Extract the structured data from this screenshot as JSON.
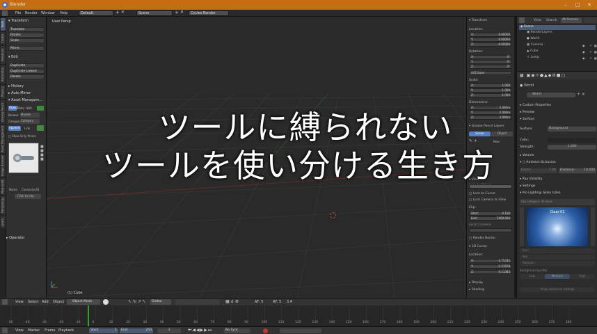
{
  "window": {
    "title": "Blender"
  },
  "menubar": {
    "items": [
      "File",
      "Render",
      "Window",
      "Help"
    ],
    "layout": "Default",
    "scene": "Scene",
    "engine": "Cycles Render"
  },
  "tabs": [
    "Tools",
    "Create",
    "Relations",
    "Animation",
    "Physics",
    "Grease Pencil",
    "Asset Management",
    "Image Browser",
    "MeasureIt",
    "Retopology",
    "Learn"
  ],
  "toolshelf": {
    "transform_header": "Transform",
    "transform_buttons": [
      "Translate",
      "Rotate",
      "Scale",
      "Mirror"
    ],
    "edit_header": "Edit",
    "edit_buttons": [
      "Duplicate",
      "Duplicate Linked",
      "Delete"
    ],
    "history_header": "History",
    "auto_mirror": "Auto Mirror",
    "asset_header": "Asset Managem...",
    "asset_row1": [
      "Object",
      "Mate",
      "HDR"
    ],
    "asset_browse": "Browse",
    "asset_models": "Models",
    "asset_category": "Category",
    "asset_replace": "Replace",
    "asset_append": "Append",
    "asset_link": "Link",
    "show_only_preview": "Show Only Previe",
    "name_label": "Name",
    "name_value": "Connector01",
    "click_to_import": "Click to imp",
    "operator_header": "Operator"
  },
  "viewport": {
    "label": "User Persp",
    "object_label": "(1) Cube"
  },
  "overlay": {
    "line1": "ツールに縛られない",
    "line2": "ツールを使い分ける生き方"
  },
  "npanel": {
    "transform_header": "Transform",
    "location_label": "Location:",
    "location": [
      "X:",
      "0.00000",
      "Y:",
      "0.00000",
      "Z:",
      "0.00000"
    ],
    "rotation_label": "Rotation:",
    "rotation": [
      "X:",
      "0°",
      "Y:",
      "0°",
      "Z:",
      "0°"
    ],
    "euler": "XYZ Euler",
    "scale_label": "Scale:",
    "scale": [
      "X:",
      "1.000",
      "Y:",
      "1.000",
      "Z:",
      "1.000"
    ],
    "dimensions_label": "Dimensions:",
    "dimensions": [
      "X:",
      "2.000m",
      "Y:",
      "2.000m",
      "Z:",
      "2.000m"
    ],
    "layers_header": "Grease Pencil Layers",
    "scene_btn": "Scene",
    "object_btn": "Object",
    "new_btn": "New",
    "view_header": "View",
    "lock_to_object": "Lock to Object:",
    "lock_to_cursor": "Lock to Cursor",
    "lock_camera": "Lock Camera to View",
    "clip_label": "Clip:",
    "clip_start_label": "Start:",
    "clip_start": "0.100",
    "clip_end_label": "End:",
    "clip_end": "1000.000",
    "local_camera": "Local Camera:",
    "render_border": "Render Border",
    "cursor_header": "3D Cursor",
    "cursor_location_label": "Location:",
    "cursor": [
      "X:",
      "-1.75335",
      "Y:",
      "-2.31528",
      "Z:",
      "0.11383"
    ],
    "display_header": "Display",
    "shading_header": "Shading"
  },
  "outliner": {
    "menu": [
      "View",
      "Search",
      "All Scenes"
    ],
    "items": [
      "Scene",
      "RenderLayers",
      "World",
      "Camera",
      "Cube",
      "Lamp"
    ]
  },
  "properties": {
    "world_label": "World",
    "world_field": "World",
    "panels": [
      "Custom Properties",
      "Preview",
      "Surface"
    ],
    "surface_label": "Surface:",
    "surface_value": "Background",
    "color_label": "Color:",
    "strength_label": "Strength:",
    "strength_value": "1.000",
    "volume": "Volume",
    "ao": "Ambient Occlusion",
    "factor_label": "Factor:",
    "factor_value": "1.00",
    "distance_label": "Distance:",
    "distance_value": "10.000",
    "ray_visibility": "Ray Visibility",
    "settings": "Settings",
    "pro_lighting": "Pro Lighting: Skies (Lite)",
    "sky_category_label": "Sky category:",
    "sky_category_value": "All Skies",
    "sky_name": "Clear 01",
    "sun_label": "Sun:",
    "sky_label": "Sky:",
    "rotation_label": "Rotation:",
    "bg_quality": "Background quality:",
    "quality_options": [
      "Low",
      "Medium",
      "High"
    ],
    "show_advanced": "Show advanced settings"
  },
  "header": {
    "items": [
      "View",
      "Select",
      "Add",
      "Object"
    ],
    "mode": "Object Mode",
    "pivot": "Global",
    "snap": "AF: 5",
    "snap2": "AF: 5",
    "extra": "3.4"
  },
  "timeline": {
    "ticks": [
      "-50",
      "-40",
      "-30",
      "-20",
      "-10",
      "0",
      "10",
      "20",
      "30",
      "40",
      "50",
      "60",
      "70",
      "80",
      "90",
      "100",
      "110",
      "120",
      "130",
      "140",
      "150",
      "160",
      "170",
      "180",
      "190",
      "200",
      "210",
      "220",
      "230",
      "240",
      "250",
      "260",
      "270",
      "280"
    ],
    "current_frame": 1
  },
  "timeline_bar": {
    "items": [
      "View",
      "Marker",
      "Frame",
      "Playback"
    ],
    "start_label": "Start:",
    "start": "1",
    "end_label": "End:",
    "end": "250",
    "current": "1",
    "sync": "No Sync"
  }
}
